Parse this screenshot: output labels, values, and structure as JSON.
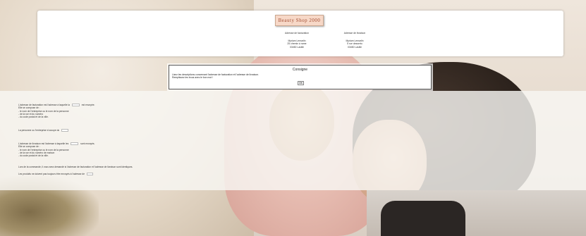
{
  "header": {
    "logo_text": "Beauty Shop 2000",
    "billing": {
      "title": "Adresse de facturation",
      "lines": [
        "Myriam Lemarlin",
        "25 chemin à rame",
        "03450 Lasille"
      ]
    },
    "delivery": {
      "title": "Adresse de livraison",
      "lines": [
        "Myriam Lemarlin",
        "5 rue dessertu",
        "03450 Lasille"
      ]
    }
  },
  "modal": {
    "title": "Consigne",
    "lines": [
      "Lisez les descriptions concernant l'adresse de facturation et l'adresse de livraison.",
      "Remplissez les trous avec le bon mot !"
    ],
    "ok_label": "OK"
  },
  "questions": {
    "q1": {
      "before": "L'adresse de facturation est l'adresse à laquelle la",
      "after": "est envoyée.",
      "lines": [
        "Elle se compose de :",
        "- le nom de l'entreprise ou le nom de la personne",
        "- de la rue et du numéro",
        "- du code postal et de la ville."
      ]
    },
    "q2": {
      "before": "La personne ou l'entreprise s'occupe du"
    },
    "q3": {
      "before": "L'adresse de livraison est l'adresse à laquelle les",
      "after": "sont envoyés.",
      "lines": [
        "Elle se compose de :",
        "- le nom de l'entreprise ou le nom de la personne",
        "- de la rue et du numéro de maison",
        "- du code postal et de la ville."
      ]
    },
    "q4": {
      "text": "Lors de la commande, il vous sera demandé si l'adresse de facturation et l'adresse de livraison sont identiques."
    },
    "q5": {
      "before": "Les produits ne doivent pas toujours être envoyés à l'adresse de"
    }
  }
}
